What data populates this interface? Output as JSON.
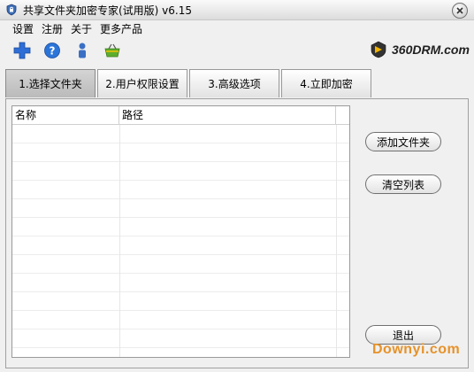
{
  "window": {
    "title": "共享文件夹加密专家(试用版) v6.15"
  },
  "menu": [
    {
      "label": "设置"
    },
    {
      "label": "注册"
    },
    {
      "label": "关于"
    },
    {
      "label": "更多产品"
    }
  ],
  "toolbar": {
    "icons": [
      "add-icon",
      "help-icon",
      "user-icon",
      "basket-icon"
    ]
  },
  "brand": {
    "text": "360DRM.com"
  },
  "tabs": [
    {
      "label": "1.选择文件夹",
      "active": true
    },
    {
      "label": "2.用户权限设置"
    },
    {
      "label": "3.高级选项"
    },
    {
      "label": "4.立即加密"
    }
  ],
  "file_list": {
    "columns": [
      {
        "label": "名称"
      },
      {
        "label": "路径"
      }
    ],
    "rows": []
  },
  "buttons": {
    "add_folder": "添加文件夹",
    "clear_list": "清空列表",
    "exit": "退出"
  },
  "watermark": {
    "text": "Downyi.com"
  },
  "colors": {
    "watermark": "#e6922a",
    "accent_blue": "#2e6ed6",
    "help_blue": "#2b74d8",
    "user_blue": "#3a6fc4",
    "basket_green": "#5cae2c"
  }
}
